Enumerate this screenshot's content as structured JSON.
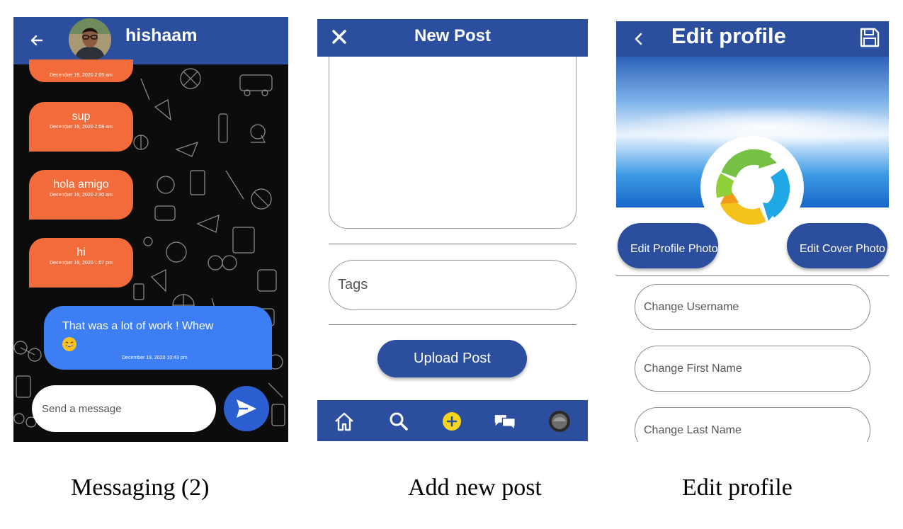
{
  "messaging": {
    "contact_name": "hishaam",
    "messages": [
      {
        "text": "",
        "time": "December 19, 2020 2:05 am"
      },
      {
        "text": "sup",
        "time": "December 19, 2020 2:08 am"
      },
      {
        "text": "hola amigo",
        "time": "December 19, 2020 2:30 am"
      },
      {
        "text": "hi",
        "time": "December 19, 2020 1:07 pm"
      }
    ],
    "sent_message": {
      "text": "That was a lot of work ! Whew",
      "time": "December 19, 2020 10:43 pm"
    },
    "input_placeholder": "Send a message",
    "colors": {
      "appbar": "#2b4f9e",
      "received_bubble": "#f26b3a",
      "sent_bubble": "#3d7ef5",
      "send_button": "#2b5fd1"
    }
  },
  "new_post": {
    "title": "New Post",
    "tags_placeholder": "Tags",
    "upload_label": "Upload Post",
    "nav_icons": [
      "home-icon",
      "search-icon",
      "add-icon",
      "chat-icon",
      "profile-avatar"
    ]
  },
  "edit_profile": {
    "title": "Edit profile",
    "edit_profile_photo": "Edit Profile Photo",
    "edit_cover_photo": "Edit Cover Photo",
    "fields": {
      "username_placeholder": "Change Username",
      "first_name_placeholder": "Change First Name",
      "last_name_placeholder": "Change Last Name"
    }
  },
  "captions": [
    "Messaging (2)",
    "Add new post",
    "Edit profile"
  ]
}
